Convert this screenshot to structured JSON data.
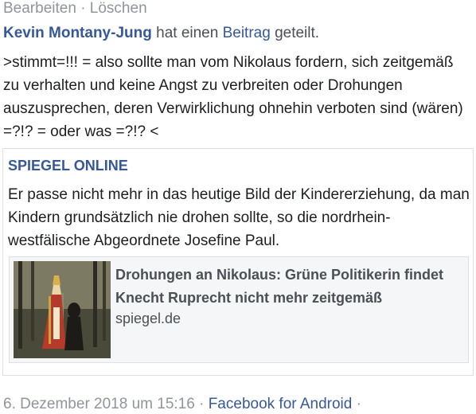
{
  "top_actions": {
    "edit_label": "Bearbeiten",
    "separator": "·",
    "delete_label": "Löschen"
  },
  "author_line": {
    "author": "Kevin Montany-Jung",
    "text_before": "hat einen",
    "post_link": "Beitrag",
    "text_after": "geteilt."
  },
  "post_text": ">stimmt=!!! = also sollte man vom Nikolaus fordern, sich zeitgemäß zu verhalten und keine Angst zu verbreiten oder Drohungen auszusprechen, deren Verwirklichung ohnehin verboten sind (wären)  =?!? = oder was =?!? <",
  "shared_post": {
    "source": "SPIEGEL ONLINE",
    "text": "Er passe nicht mehr in das heutige Bild der Kindererziehung, da man Kindern grundsätzlich nie drohen sollte, so die nordrhein-westfälische  Abgeordnete Josefine Paul.",
    "link_preview": {
      "title": "Drohungen an Nikolaus: Grüne Politikerin findet Knecht Ruprecht nicht mehr zeitgemäß",
      "domain": "spiegel.de"
    }
  },
  "footer": {
    "date": "6. Dezember  2018 um 15:16",
    "separator": "·",
    "app": "Facebook for Android",
    "trailing_separator": "·"
  },
  "colors": {
    "link_blue": "#365899",
    "meta_gray": "#90949c",
    "text": "#1c1e21",
    "card_border": "#dddfe2"
  }
}
